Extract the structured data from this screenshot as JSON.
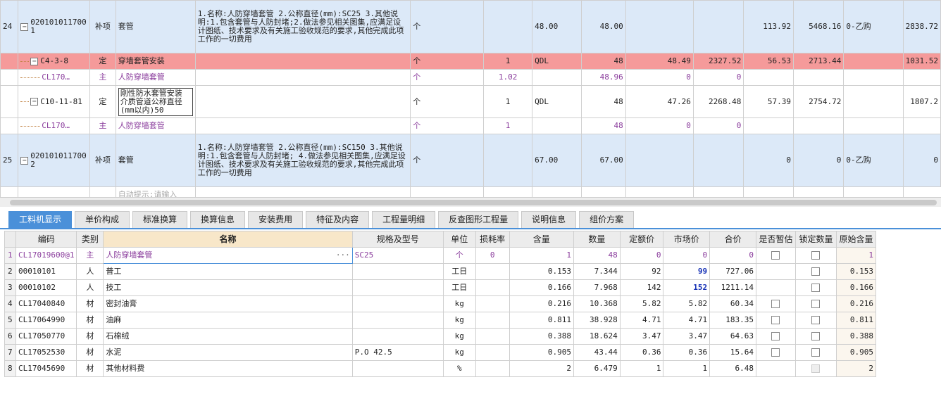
{
  "upper_rows": [
    {
      "kind": "bq",
      "seq": "24",
      "code": "020101011700 1",
      "cat": "补项",
      "name": "套管",
      "feature": "1.名称:人防穿墙套管\n2.公称直径(mm):SC25\n3.其他说明:1.包含套管与人防封堵;2.做法参见相关图集,应满足设计图纸、技术要求及有关施工验收规范的要求,其他完成此项工作的一切费用",
      "unit": "个",
      "expr": "",
      "qty": "48.00",
      "c1": "48.00",
      "c2": "",
      "c3": "",
      "c4": "113.92",
      "c5": "5468.16",
      "c6": "0-乙购",
      "c7": "2838.72"
    },
    {
      "kind": "de",
      "seq": "",
      "code": "C4-3-8",
      "cat": "定",
      "name": "穿墙套管安装",
      "feature": "",
      "unit": "个",
      "expr": "1",
      "qty": "QDL",
      "c1": "48",
      "c2": "48.49",
      "c3": "2327.52",
      "c4": "56.53",
      "c5": "2713.44",
      "c6": "",
      "c7": "1031.52"
    },
    {
      "kind": "main",
      "seq": "",
      "code": "CL170…",
      "cat": "主",
      "name": "人防穿墙套管",
      "feature": "",
      "unit": "个",
      "expr": "1.02",
      "qty": "",
      "c1": "48.96",
      "c2": "0",
      "c3": "0",
      "c4": "",
      "c5": "",
      "c6": "",
      "c7": ""
    },
    {
      "kind": "sub",
      "seq": "",
      "code": "C10-11-81",
      "cat": "定",
      "name": "刚性防水套管安装 介质管道公称直径 (mm以内)50",
      "feature": "",
      "unit": "个",
      "expr": "1",
      "qty": "QDL",
      "c1": "48",
      "c2": "47.26",
      "c3": "2268.48",
      "c4": "57.39",
      "c5": "2754.72",
      "c6": "",
      "c7": "1807.2"
    },
    {
      "kind": "main",
      "seq": "",
      "code": "CL170…",
      "cat": "主",
      "name": "人防穿墙套管",
      "feature": "",
      "unit": "个",
      "expr": "1",
      "qty": "",
      "c1": "48",
      "c2": "0",
      "c3": "0",
      "c4": "",
      "c5": "",
      "c6": "",
      "c7": ""
    },
    {
      "kind": "bq",
      "seq": "25",
      "code": "020101011700 2",
      "cat": "补项",
      "name": "套管",
      "feature": "1.名称:人防穿墙套管\n2.公称直径(mm):SC150\n3.其他说明:1.包含套管与人防封堵;\n4.做法参见相关图集,应满足设计图纸、技术要求及有关施工验收规范的要求,其他完成此项工作的一切费用",
      "unit": "个",
      "expr": "",
      "qty": "67.00",
      "c1": "67.00",
      "c2": "",
      "c3": "",
      "c4": "0",
      "c5": "0",
      "c6": "0-乙购",
      "c7": "0"
    }
  ],
  "hint_text": "自动提示:请输入",
  "tabs": [
    "工料机显示",
    "单价构成",
    "标准换算",
    "换算信息",
    "安装费用",
    "特征及内容",
    "工程量明细",
    "反查图形工程量",
    "说明信息",
    "组价方案"
  ],
  "lower_headers": [
    "",
    "编码",
    "类别",
    "名称",
    "规格及型号",
    "单位",
    "损耗率",
    "含量",
    "数量",
    "定额价",
    "市场价",
    "合价",
    "是否暂估",
    "锁定数量",
    "原始含量"
  ],
  "lower_rows": [
    {
      "n": "1",
      "code": "CL17019600@1",
      "cat": "主",
      "name": "人防穿墙套管",
      "spec": "SC25",
      "unit": "个",
      "loss": "0",
      "content": "1",
      "qty": "48",
      "quota": "0",
      "market": "0",
      "total": "0",
      "est": true,
      "lock": true,
      "orig": "1"
    },
    {
      "n": "2",
      "code": "00010101",
      "cat": "人",
      "name": "普工",
      "spec": "",
      "unit": "工日",
      "loss": "",
      "content": "0.153",
      "qty": "7.344",
      "quota": "92",
      "market": "99",
      "total": "727.06",
      "est": false,
      "lock": true,
      "orig": "0.153"
    },
    {
      "n": "3",
      "code": "00010102",
      "cat": "人",
      "name": "技工",
      "spec": "",
      "unit": "工日",
      "loss": "",
      "content": "0.166",
      "qty": "7.968",
      "quota": "142",
      "market": "152",
      "total": "1211.14",
      "est": false,
      "lock": true,
      "orig": "0.166"
    },
    {
      "n": "4",
      "code": "CL17040840",
      "cat": "材",
      "name": "密封油膏",
      "spec": "",
      "unit": "kg",
      "loss": "",
      "content": "0.216",
      "qty": "10.368",
      "quota": "5.82",
      "market": "5.82",
      "total": "60.34",
      "est": true,
      "lock": true,
      "orig": "0.216"
    },
    {
      "n": "5",
      "code": "CL17064990",
      "cat": "材",
      "name": "油麻",
      "spec": "",
      "unit": "kg",
      "loss": "",
      "content": "0.811",
      "qty": "38.928",
      "quota": "4.71",
      "market": "4.71",
      "total": "183.35",
      "est": true,
      "lock": true,
      "orig": "0.811"
    },
    {
      "n": "6",
      "code": "CL17050770",
      "cat": "材",
      "name": "石棉绒",
      "spec": "",
      "unit": "kg",
      "loss": "",
      "content": "0.388",
      "qty": "18.624",
      "quota": "3.47",
      "market": "3.47",
      "total": "64.63",
      "est": true,
      "lock": true,
      "orig": "0.388"
    },
    {
      "n": "7",
      "code": "CL17052530",
      "cat": "材",
      "name": "水泥",
      "spec": "P.O 42.5",
      "unit": "kg",
      "loss": "",
      "content": "0.905",
      "qty": "43.44",
      "quota": "0.36",
      "market": "0.36",
      "total": "15.64",
      "est": true,
      "lock": true,
      "orig": "0.905"
    },
    {
      "n": "8",
      "code": "CL17045690",
      "cat": "材",
      "name": "其他材料费",
      "spec": "",
      "unit": "%",
      "loss": "",
      "content": "2",
      "qty": "6.479",
      "quota": "1",
      "market": "1",
      "total": "6.48",
      "est": false,
      "lock": "disabled",
      "orig": "2"
    }
  ],
  "colors": {
    "bq_row": "#dce9f8",
    "de_row": "#f59a9a",
    "main_text": "#8a3c9c",
    "tab_active": "#4a90d9",
    "market_highlight": "#1530b5"
  }
}
